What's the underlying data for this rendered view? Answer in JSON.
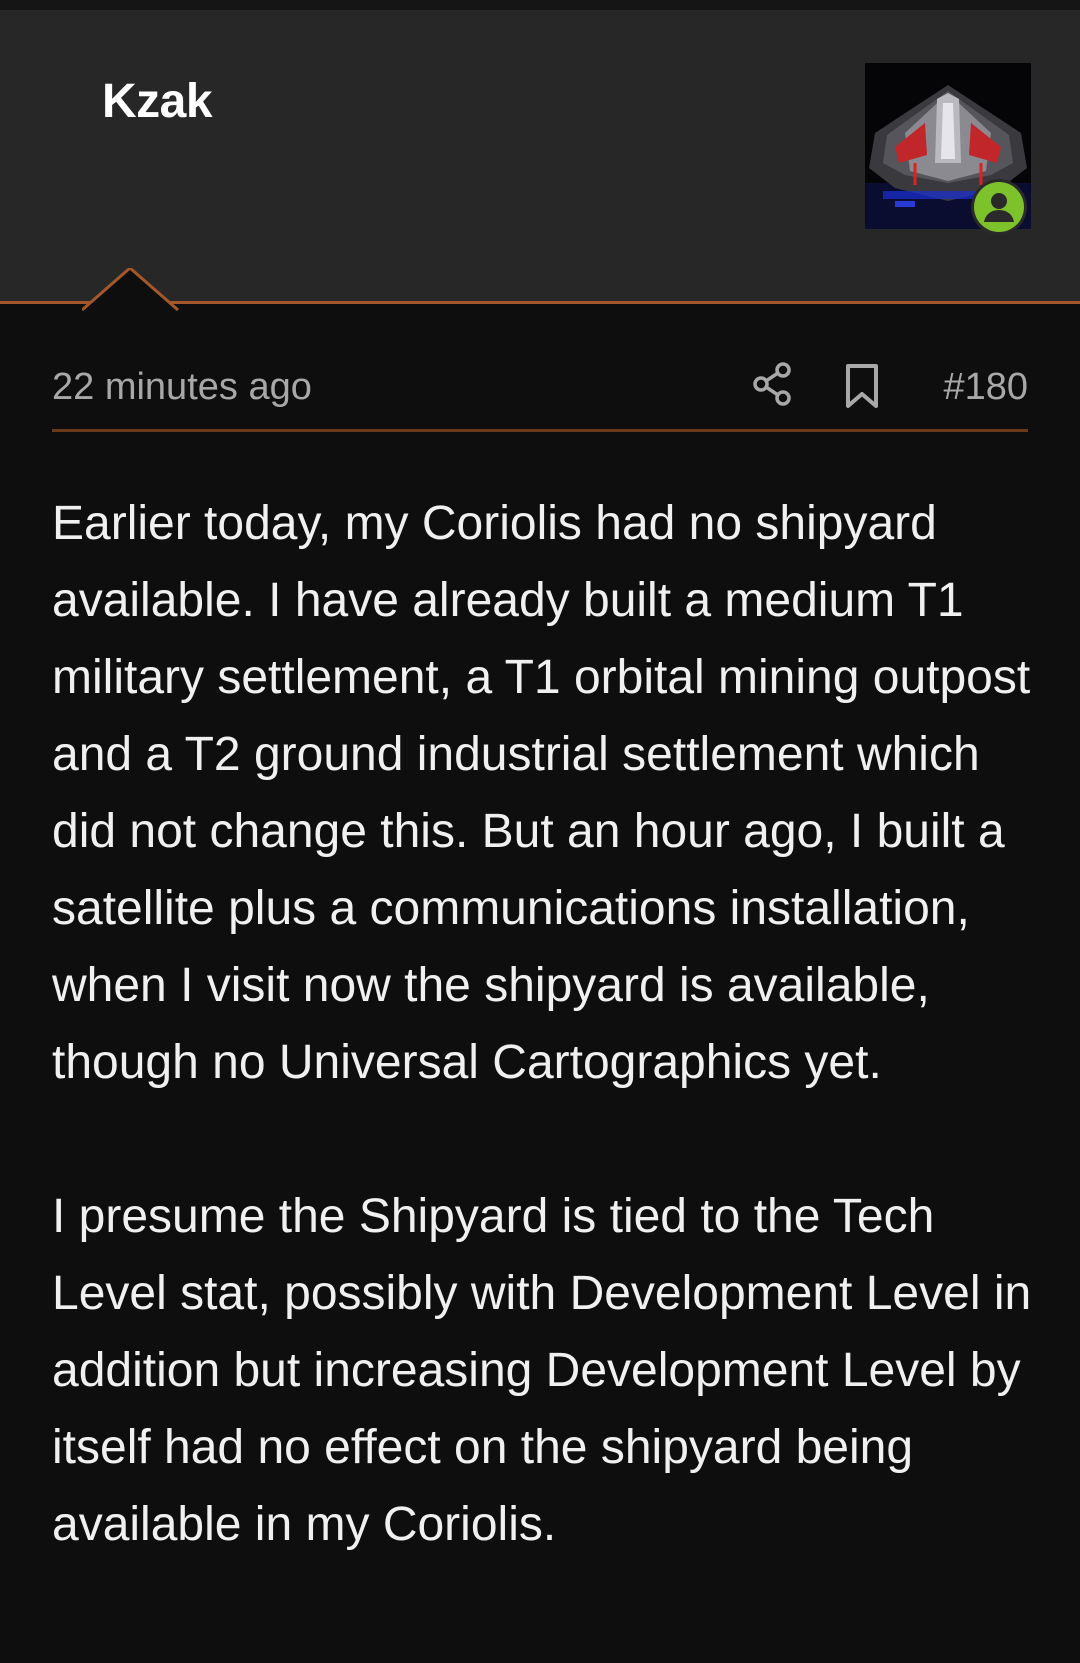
{
  "post": {
    "author": "Kzak",
    "timestamp": "22 minutes ago",
    "number": "#180",
    "paragraphs": [
      "Earlier today, my Coriolis had no shipyard available. I have already built a medium T1 military settlement, a T1 orbital mining outpost and a T2 ground industrial settlement which did not change this. But an hour ago, I built a satellite plus a communications installation, when I visit now the shipyard is available, though no Universal Cartographics yet.",
      "I presume the Shipyard is tied to the Tech Level stat, possibly with Development Level in addition but increasing Development Level by itself had no effect on the shipyard being available in my Coriolis."
    ]
  },
  "icons": {
    "share": "share-icon",
    "bookmark": "bookmark-icon",
    "online": "user-online-icon"
  },
  "colors": {
    "header_bg": "#272727",
    "page_bg": "#0e0e0e",
    "accent": "#a3582a",
    "online": "#7dc12b"
  }
}
